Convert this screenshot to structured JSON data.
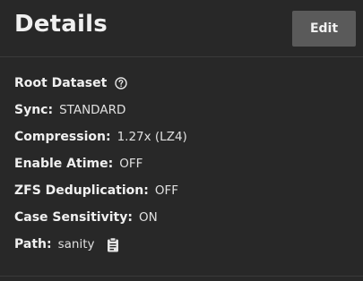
{
  "header": {
    "title": "Details",
    "edit_label": "Edit"
  },
  "details": {
    "root_dataset": {
      "label": "Root Dataset"
    },
    "sync": {
      "label": "Sync:",
      "value": "STANDARD"
    },
    "compression": {
      "label": "Compression:",
      "value": "1.27x (LZ4)"
    },
    "atime": {
      "label": "Enable Atime:",
      "value": "OFF"
    },
    "dedup": {
      "label": "ZFS Deduplication:",
      "value": "OFF"
    },
    "case": {
      "label": "Case Sensitivity:",
      "value": "ON"
    },
    "path": {
      "label": "Path:",
      "value": "sanity"
    }
  },
  "icons": {
    "help": "help-circle-icon",
    "copy": "clipboard-icon"
  },
  "colors": {
    "background": "#282828",
    "button": "#5a5a5a",
    "text": "#e6e6e6"
  }
}
